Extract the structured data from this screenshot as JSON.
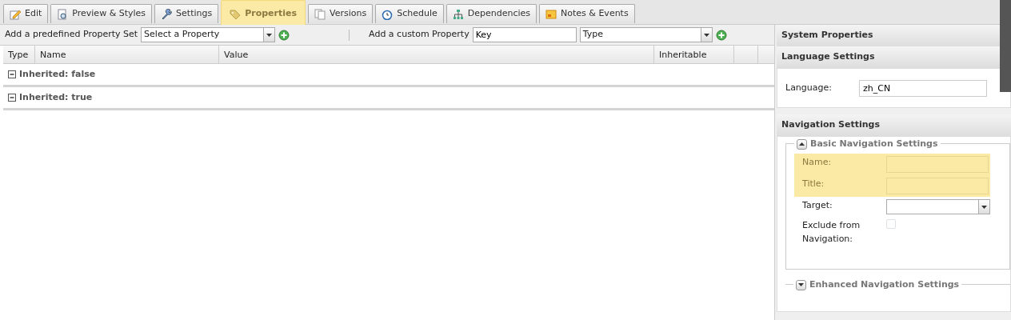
{
  "tabs": [
    {
      "label": "Edit",
      "selected": false
    },
    {
      "label": "Preview & Styles",
      "selected": false
    },
    {
      "label": "Settings",
      "selected": false
    },
    {
      "label": "Properties",
      "selected": true
    },
    {
      "label": "Versions",
      "selected": false
    },
    {
      "label": "Schedule",
      "selected": false
    },
    {
      "label": "Dependencies",
      "selected": false
    },
    {
      "label": "Notes & Events",
      "selected": false
    }
  ],
  "toolbar": {
    "predefined_label": "Add a predefined Property Set",
    "predefined_select": "Select a Property",
    "custom_label": "Add a custom Property",
    "key_field": "Key",
    "type_select": "Type"
  },
  "table": {
    "columns": [
      "Type",
      "Name",
      "Value",
      "Inheritable"
    ],
    "groups": [
      {
        "label": "Inherited: false",
        "expanded": true
      },
      {
        "label": "Inherited: true",
        "expanded": true
      }
    ]
  },
  "system_properties": {
    "title": "System Properties",
    "language_settings": {
      "title": "Language Settings",
      "label": "Language:",
      "value": "zh_CN"
    },
    "navigation_settings": {
      "title": "Navigation Settings",
      "fieldsets": [
        {
          "legend": "Basic Navigation Settings",
          "expanded": true,
          "fields": [
            {
              "label": "Name:",
              "kind": "text",
              "highlighted": true
            },
            {
              "label": "Title:",
              "kind": "text",
              "highlighted": true
            },
            {
              "label": "Target:",
              "kind": "select",
              "highlighted": false
            },
            {
              "label": "Exclude from Navigation:",
              "kind": "checkbox",
              "checked": false,
              "highlighted": false
            }
          ]
        },
        {
          "legend": "Enhanced Navigation Settings",
          "expanded": false
        }
      ]
    }
  }
}
